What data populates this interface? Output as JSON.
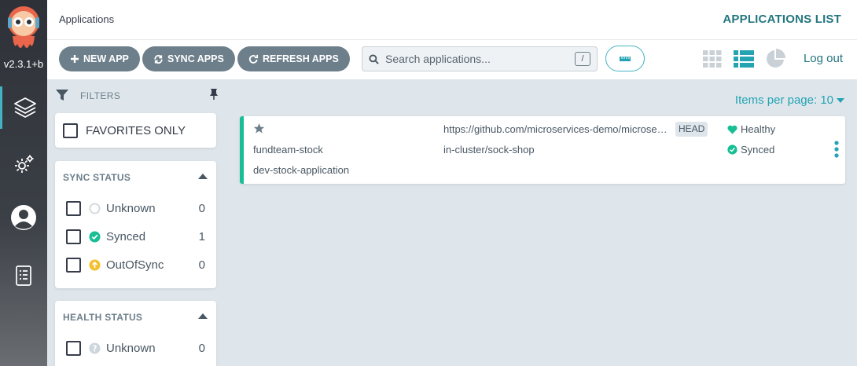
{
  "nav": {
    "version": "v2.3.1+b",
    "items": [
      "applications-icon",
      "settings-icon",
      "user-icon",
      "docs-icon"
    ]
  },
  "header": {
    "breadcrumb": "Applications",
    "title": "APPLICATIONS LIST"
  },
  "toolbar": {
    "new_app": "NEW APP",
    "sync_apps": "SYNC APPS",
    "refresh_apps": "REFRESH APPS",
    "search_placeholder": "Search applications...",
    "search_shortcut": "/",
    "logout": "Log out",
    "active_view": "list"
  },
  "filters": {
    "label": "FILTERS",
    "favorites_only": "FAVORITES ONLY",
    "sync_status": {
      "title": "SYNC STATUS",
      "items": [
        {
          "label": "Unknown",
          "count": "0"
        },
        {
          "label": "Synced",
          "count": "1"
        },
        {
          "label": "OutOfSync",
          "count": "0"
        }
      ]
    },
    "health_status": {
      "title": "HEALTH STATUS",
      "items": [
        {
          "label": "Unknown",
          "count": "0"
        }
      ]
    }
  },
  "pagination": {
    "items_per_page": "Items per page: 10"
  },
  "app": {
    "name": "fundteam-stock",
    "project": "dev-stock-application",
    "repo": "https://github.com/microservices-demo/microse…",
    "revision": "HEAD",
    "destination": "in-cluster/sock-shop",
    "health": "Healthy",
    "sync": "Synced"
  },
  "colors": {
    "accent": "#24767f",
    "teal": "#44b3c1",
    "healthy": "#18be94",
    "outofsync": "#f4c030",
    "button": "#6d7f8b"
  }
}
